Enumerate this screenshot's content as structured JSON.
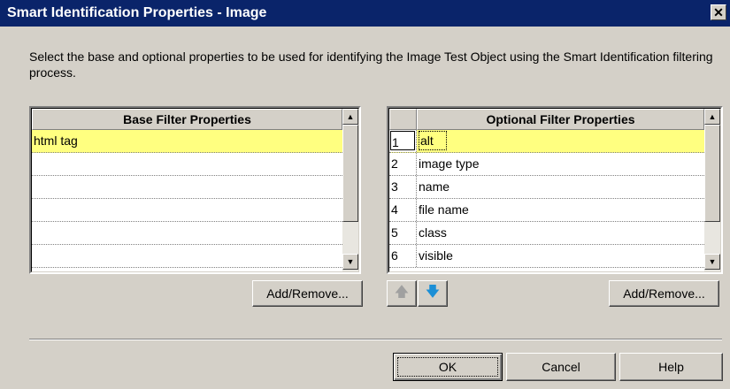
{
  "window": {
    "title": "Smart Identification Properties - Image",
    "close_label": "✕"
  },
  "description": "Select the base and optional properties to be used for identifying the Image Test Object using the Smart Identification filtering process.",
  "base_panel": {
    "header": "Base Filter Properties",
    "rows": [
      "html tag",
      "",
      "",
      "",
      "",
      ""
    ],
    "add_remove_label": "Add/Remove..."
  },
  "optional_panel": {
    "header": "Optional Filter Properties",
    "rows": [
      {
        "index": "1",
        "name": "alt"
      },
      {
        "index": "2",
        "name": "image type"
      },
      {
        "index": "3",
        "name": "name"
      },
      {
        "index": "4",
        "name": "file name"
      },
      {
        "index": "5",
        "name": "class"
      },
      {
        "index": "6",
        "name": "visible"
      }
    ],
    "add_remove_label": "Add/Remove...",
    "up_label": "🡅",
    "down_label": "🡇"
  },
  "footer": {
    "ok_label": "OK",
    "cancel_label": "Cancel",
    "help_label": "Help"
  },
  "colors": {
    "titlebar": "#0a246a",
    "selection": "#ffff80",
    "down_arrow": "#1c8fd6",
    "up_arrow_disabled": "#a0a0a0"
  }
}
